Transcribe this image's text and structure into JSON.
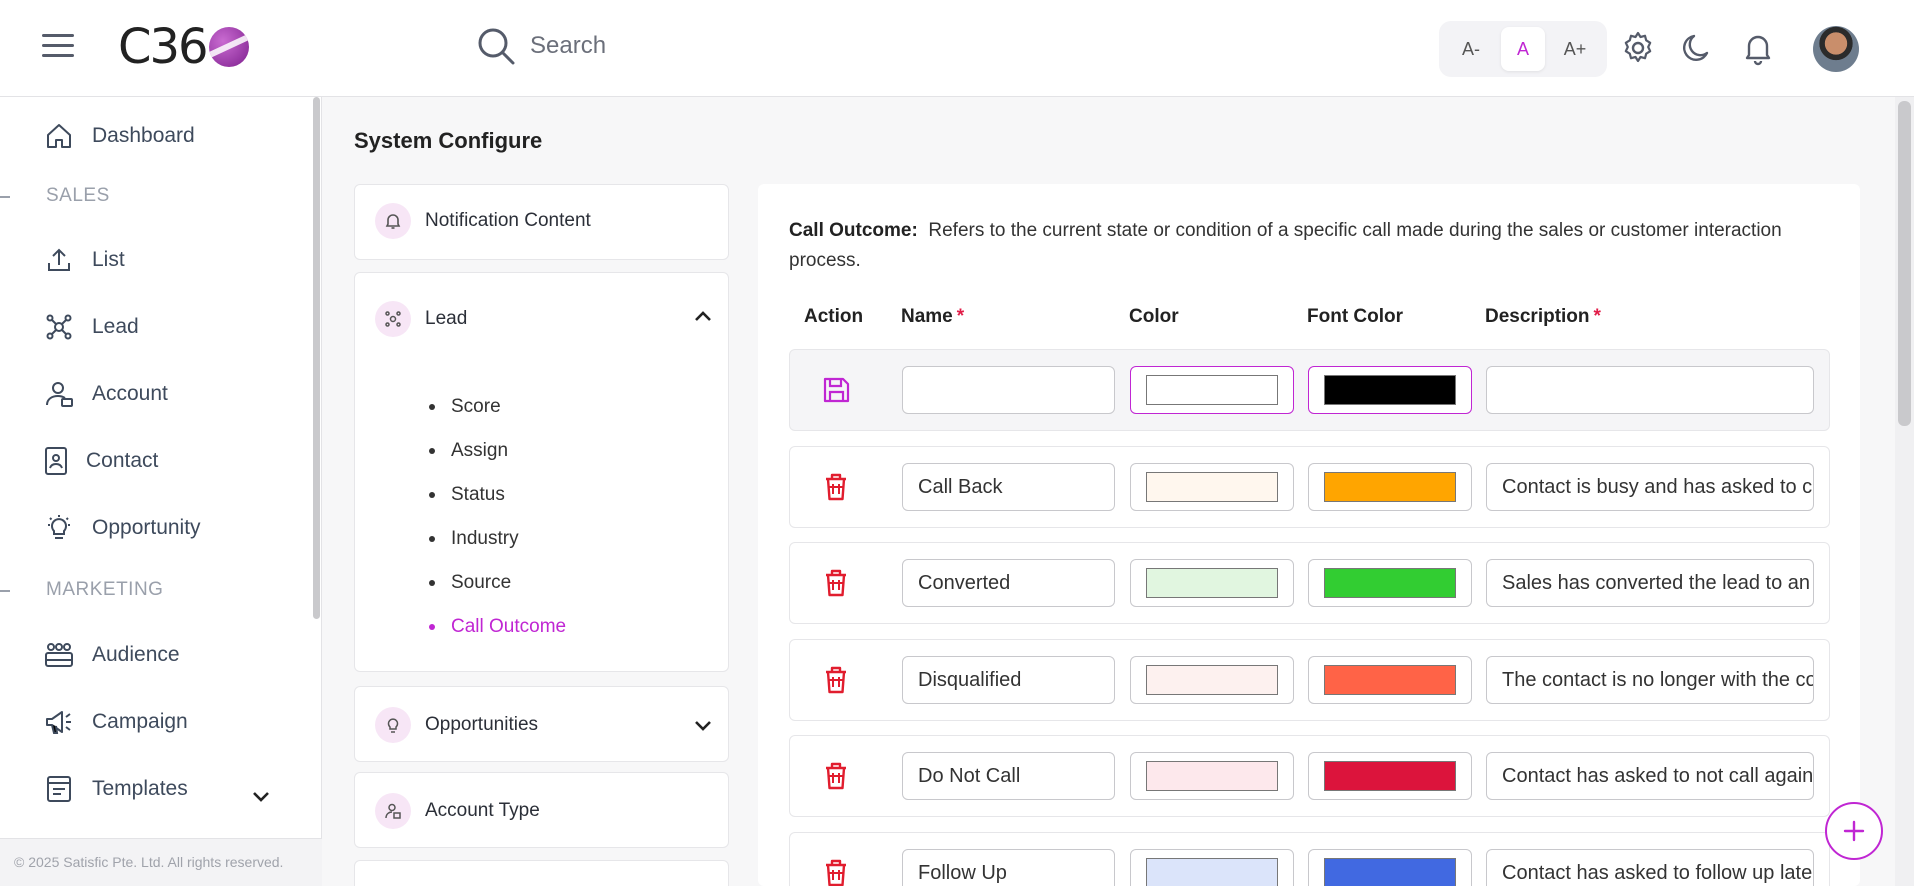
{
  "header": {
    "logo_text": "C36",
    "search_placeholder": "Search",
    "font_controls": [
      "A-",
      "A",
      "A+"
    ],
    "accent_color": "#c026d3"
  },
  "sidebar": {
    "items": [
      {
        "label": "Dashboard",
        "icon": "home-icon"
      },
      {
        "label": "List",
        "icon": "upload-icon"
      },
      {
        "label": "Lead",
        "icon": "lead-network-icon"
      },
      {
        "label": "Account",
        "icon": "account-icon"
      },
      {
        "label": "Contact",
        "icon": "contact-card-icon"
      },
      {
        "label": "Opportunity",
        "icon": "lightbulb-icon"
      },
      {
        "label": "Audience",
        "icon": "audience-icon"
      },
      {
        "label": "Campaign",
        "icon": "megaphone-icon"
      },
      {
        "label": "Templates",
        "icon": "templates-icon"
      }
    ],
    "sections": [
      "SALES",
      "MARKETING"
    ],
    "copyright": "© 2025 Satisfic Pte. Ltd. All rights reserved."
  },
  "main": {
    "page_title": "System Configure",
    "config_nav": {
      "notification": "Notification Content",
      "lead": "Lead",
      "lead_sub": [
        "Score",
        "Assign",
        "Status",
        "Industry",
        "Source",
        "Call Outcome"
      ],
      "active_sub": "Call Outcome",
      "opportunities": "Opportunities",
      "account_type": "Account Type"
    },
    "panel": {
      "heading": "Call Outcome:",
      "description": "Refers to the current state or condition of a specific call made during the sales or customer interaction process.",
      "columns": [
        "Action",
        "Name",
        "Color",
        "Font Color",
        "Description"
      ],
      "required_mark": "*",
      "new_row": {
        "name": "",
        "color": "#ffffff",
        "font_color": "#000000",
        "description": ""
      },
      "rows": [
        {
          "name": "Call Back",
          "color": "#fff7ee",
          "font_color": "#ffa500",
          "description": "Contact is busy and has asked to call back later"
        },
        {
          "name": "Converted",
          "color": "#e1f6e0",
          "font_color": "#32cd32",
          "description": "Sales has converted the lead to an opportunity"
        },
        {
          "name": "Disqualified",
          "color": "#fdf1ef",
          "font_color": "#ff6347",
          "description": "The contact is no longer with the company"
        },
        {
          "name": "Do Not Call",
          "color": "#fde8ec",
          "font_color": "#dc143c",
          "description": "Contact has asked to not call again"
        },
        {
          "name": "Follow Up",
          "color": "#dbe4fa",
          "font_color": "#4169e1",
          "description": "Contact has asked to follow up later"
        }
      ]
    }
  }
}
